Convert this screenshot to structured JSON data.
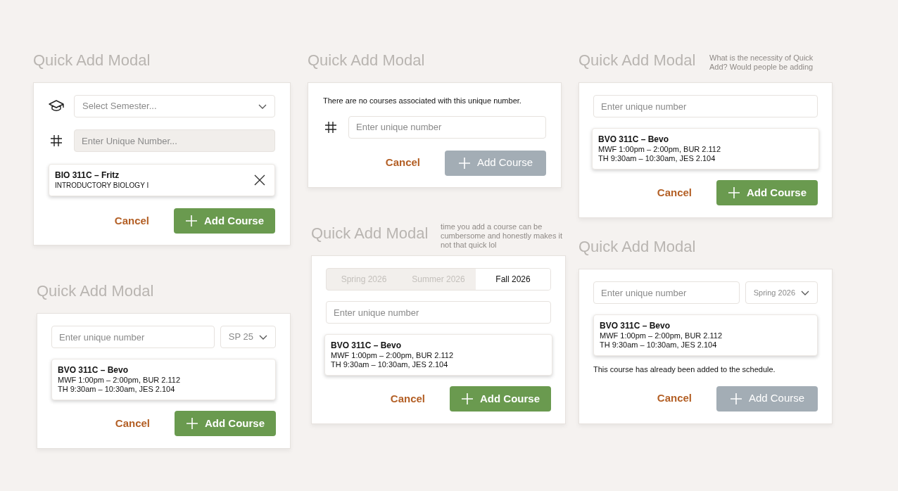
{
  "modals": [
    {
      "title": "Quick Add Modal",
      "icons": true,
      "semester_select": {
        "placeholder": "Select Semester..."
      },
      "unique_field": {
        "placeholder": "Enter Unique Number...",
        "disabled": true
      },
      "course": {
        "title": "BIO 311C – Fritz",
        "lines": [
          "INTRODUCTORY BIOLOGY I"
        ],
        "removable": true
      },
      "cancel": "Cancel",
      "add": {
        "label": "Add Course",
        "disabled": false
      }
    },
    {
      "title": "Quick Add Modal",
      "icons": true,
      "message": "There are no courses associated with this unique number.",
      "unique_field": {
        "placeholder": "Enter unique number",
        "disabled": false
      },
      "cancel": "Cancel",
      "add": {
        "label": "Add Course",
        "disabled": true
      }
    },
    {
      "title": "Quick Add Modal",
      "note": "What is the necessity of Quick Add? Would people be adding",
      "unique_field": {
        "placeholder": "Enter unique number",
        "disabled": false
      },
      "course": {
        "title": "BVO 311C – Bevo",
        "lines": [
          "MWF 1:00pm – 2:00pm, BUR 2.112",
          "TH 9:30am – 10:30am, JES 2.104"
        ],
        "removable": false
      },
      "cancel": "Cancel",
      "add": {
        "label": "Add Course",
        "disabled": false
      }
    },
    {
      "title": "Quick Add Modal",
      "unique_field": {
        "placeholder": "Enter unique number",
        "disabled": false
      },
      "semester_select": {
        "value": "SP 25"
      },
      "course": {
        "title": "BVO 311C – Bevo",
        "lines": [
          "MWF 1:00pm – 2:00pm, BUR 2.112",
          "TH 9:30am – 10:30am, JES 2.104"
        ],
        "removable": false
      },
      "cancel": "Cancel",
      "add": {
        "label": "Add Course",
        "disabled": false
      }
    },
    {
      "title": "Quick Add Modal",
      "note": "time you add a course can be cumbersome and honestly makes it not that quick lol",
      "tabs": [
        {
          "label": "Spring 2026",
          "selected": false
        },
        {
          "label": "Summer 2026",
          "selected": false
        },
        {
          "label": "Fall 2026",
          "selected": true
        }
      ],
      "unique_field": {
        "placeholder": "Enter unique number",
        "disabled": false
      },
      "course": {
        "title": "BVO 311C – Bevo",
        "lines": [
          "MWF 1:00pm – 2:00pm, BUR 2.112",
          "TH 9:30am – 10:30am, JES 2.104"
        ],
        "removable": false
      },
      "cancel": "Cancel",
      "add": {
        "label": "Add Course",
        "disabled": false
      }
    },
    {
      "title": "Quick Add Modal",
      "unique_field": {
        "placeholder": "Enter unique number",
        "disabled": false
      },
      "semester_select": {
        "value": "Spring 2026"
      },
      "course": {
        "title": "BVO 311C – Bevo",
        "lines": [
          "MWF 1:00pm – 2:00pm, BUR 2.112",
          "TH 9:30am – 10:30am, JES 2.104"
        ],
        "removable": false
      },
      "message": "This course has already been added to the schedule.",
      "cancel": "Cancel",
      "add": {
        "label": "Add Course",
        "disabled": true
      }
    }
  ]
}
